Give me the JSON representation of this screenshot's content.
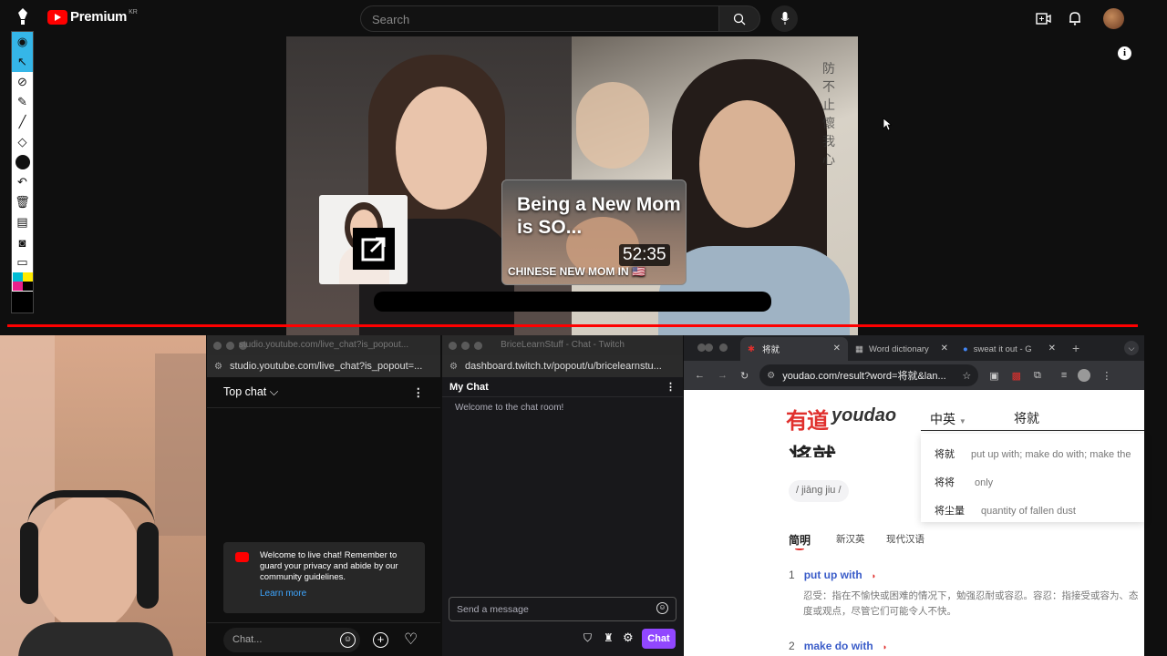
{
  "youtube": {
    "brand": "Premium",
    "region": "KR",
    "search_placeholder": "Search"
  },
  "video": {
    "related_title": "Being a New Mom is SO...",
    "related_duration": "52:35",
    "related_subtitle": "CHINESE NEW MOM IN 🇺🇸",
    "progress_percent": 100
  },
  "youtube_chat": {
    "window_title": "studio.youtube.com/live_chat?is_popout...",
    "url": "studio.youtube.com/live_chat?is_popout=...",
    "mode": "Top chat",
    "welcome": "Welcome to live chat! Remember to guard your privacy and abide by our community guidelines.",
    "learn_more": "Learn more",
    "input_placeholder": "Chat..."
  },
  "twitch_chat": {
    "window_title": "BriceLearnStuff - Chat - Twitch",
    "url": "dashboard.twitch.tv/popout/u/bricelearnstu...",
    "header": "My Chat",
    "welcome": "Welcome to the chat room!",
    "input_placeholder": "Send a message",
    "chat_button": "Chat"
  },
  "youdao": {
    "tabs": [
      {
        "label": "将就",
        "active": true
      },
      {
        "label": "Word dictionary",
        "active": false
      },
      {
        "label": "sweat it out - G",
        "active": false
      }
    ],
    "url": "youdao.com/result?word=将就&lan...",
    "logo_cn": "有道",
    "logo_en": "youdao",
    "lang": "中英",
    "query": "将就",
    "suggestions": [
      {
        "word": "将就",
        "def": "put up with; make do with; make the"
      },
      {
        "word": "将将",
        "def": "only"
      },
      {
        "word": "将尘量",
        "def": "quantity of fallen dust"
      }
    ],
    "headword": "将就",
    "pinyin": "/ jiāng jiu /",
    "dict_tabs": [
      "简明",
      "新汉英",
      "现代汉语"
    ],
    "definitions": [
      {
        "num": "1",
        "en": "put up with"
      },
      {
        "num": "2",
        "en": "make do with"
      }
    ],
    "explanation": "忍受：指在不愉快或困难的情况下，勉强忍耐或容忍。容忍：指接受或容为、态度或观点，尽管它们可能令人不快。"
  },
  "colors": {
    "youtube_red": "#ff0000",
    "twitch_purple": "#9147ff",
    "youdao_red": "#e0302d",
    "link_blue": "#3ea6ff"
  }
}
